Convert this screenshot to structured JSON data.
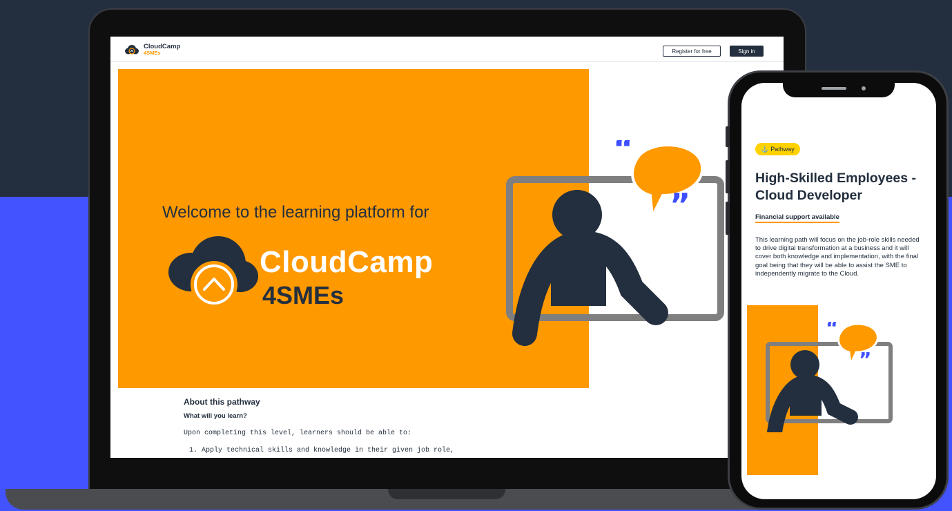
{
  "laptop": {
    "header": {
      "logo_name": "CloudCamp",
      "logo_sub": "4SMEs",
      "register_label": "Register for free",
      "signin_label": "Sign in"
    },
    "hero": {
      "welcome": "Welcome to the learning platform for",
      "brand_name": "CloudCamp",
      "brand_sub": "4SMEs"
    },
    "about": {
      "title": "About this pathway",
      "subtitle": "What will you learn?",
      "intro": "Upon completing this level, learners should be able to:",
      "items": [
        "1. Apply technical skills and knowledge in their given job role,"
      ]
    }
  },
  "phone": {
    "badge": "Pathway",
    "title": "High-Skilled Employees - Cloud Developer",
    "financial": "Financial support available",
    "description": "This learning path will focus on the job-role skills needed to drive digital transformation at a business and it will cover both knowledge and implementation, with the final goal being that they will be able to assist the SME to independently migrate to the Cloud."
  },
  "colors": {
    "navy": "#232f3e",
    "orange": "#ff9900",
    "blue": "#4353ff",
    "quote_blue": "#3d4fff",
    "badge_yellow": "#ffd200",
    "frame_gray": "#7f7f7f"
  }
}
